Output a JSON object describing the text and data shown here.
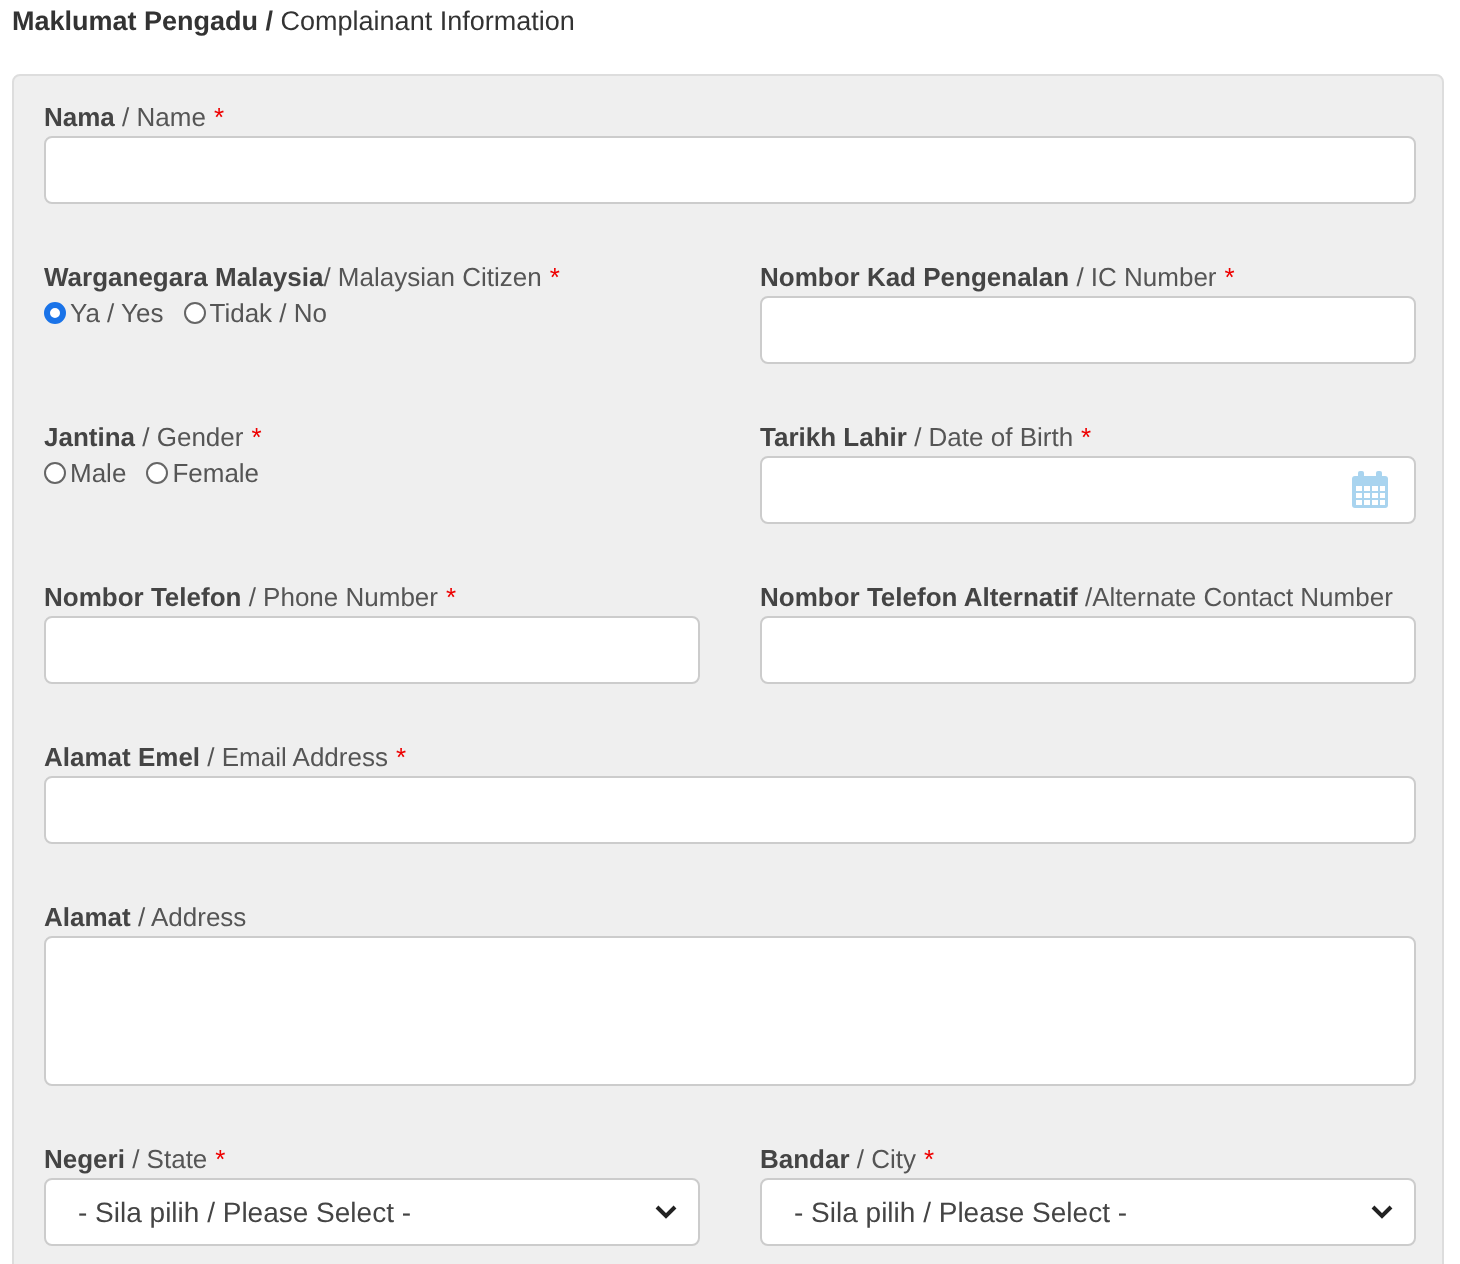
{
  "section_title": "**Maklumat Pengadu /** Complainant Information",
  "rows": [
    {
      "fields": [
        {
          "kind": "text",
          "label": "**Nama** / Name",
          "required_mark": "*"
        }
      ]
    },
    {
      "fields": [
        {
          "kind": "radio",
          "label": "**Warganegara Malaysia**/ Malaysian Citizen",
          "required_mark": "*",
          "options": [
            {
              "label": "Ya / Yes",
              "selected": true
            },
            {
              "label": "Tidak / No",
              "selected": false
            }
          ]
        },
        {
          "kind": "text",
          "label": "**Nombor Kad Pengenalan**  / IC Number",
          "required_mark": "*"
        }
      ]
    },
    {
      "fields": [
        {
          "kind": "radio",
          "label": "**Jantina** / Gender",
          "required_mark": "*",
          "options": [
            {
              "label": "Male",
              "selected": false
            },
            {
              "label": "Female",
              "selected": false
            }
          ]
        },
        {
          "kind": "date",
          "label": "**Tarikh Lahir** / Date of Birth",
          "required_mark": "*"
        }
      ]
    },
    {
      "fields": [
        {
          "kind": "text",
          "label": "**Nombor Telefon** / Phone Number",
          "required_mark": "*"
        },
        {
          "kind": "text",
          "label": "**Nombor Telefon Alternatif** /Alternate Contact Number"
        }
      ]
    },
    {
      "fields": [
        {
          "kind": "text",
          "label": "**Alamat Emel** / Email Address",
          "required_mark": "*"
        }
      ]
    },
    {
      "fields": [
        {
          "kind": "textarea",
          "label": "**Alamat** / Address"
        }
      ]
    },
    {
      "fields": [
        {
          "kind": "select",
          "label": "**Negeri** / State",
          "required_mark": "*",
          "value": "- Sila pilih / Please Select -"
        },
        {
          "kind": "select",
          "label": "**Bandar** / City",
          "required_mark": "*",
          "value": "- Sila pilih / Please Select -"
        }
      ]
    }
  ]
}
